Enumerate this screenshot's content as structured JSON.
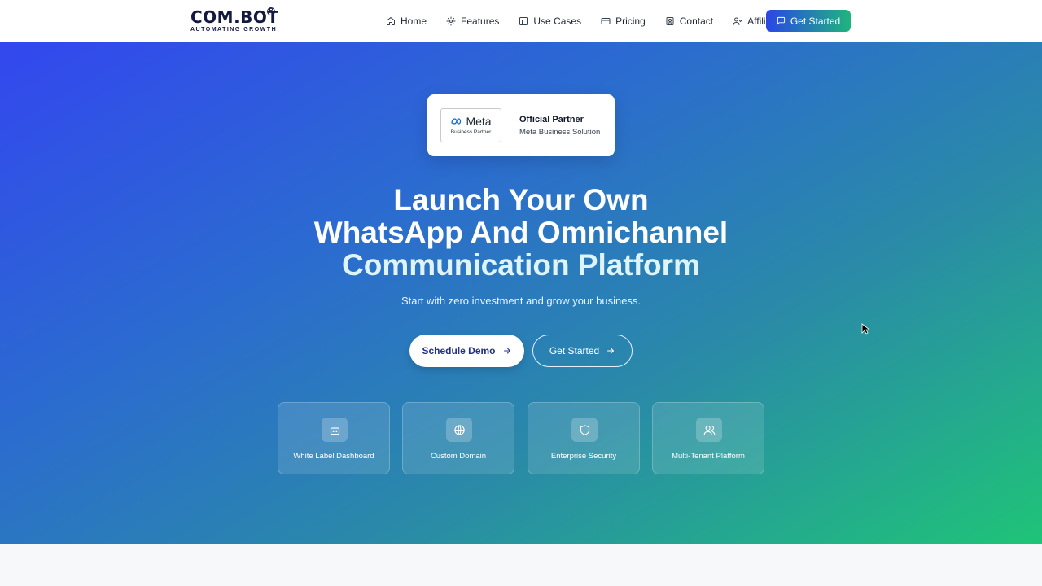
{
  "brand": {
    "name": "COM.BOT",
    "tagline": "AUTOMATING GROWTH",
    "registered_mark": "R"
  },
  "nav": {
    "items": [
      {
        "label": "Home",
        "icon": "home-icon"
      },
      {
        "label": "Features",
        "icon": "gear-icon"
      },
      {
        "label": "Use Cases",
        "icon": "layout-icon"
      },
      {
        "label": "Pricing",
        "icon": "credit-card-icon"
      },
      {
        "label": "Contact",
        "icon": "contact-icon"
      },
      {
        "label": "Affiliate",
        "icon": "users-icon"
      }
    ],
    "cta_label": "Get Started",
    "cta_icon": "message-icon"
  },
  "partner_badge": {
    "logo_text": "Meta",
    "logo_sub": "Business Partner",
    "title": "Official Partner",
    "subtitle": "Meta Business Solution"
  },
  "hero": {
    "headline_line1": "Launch Your Own",
    "headline_line2": "WhatsApp And Omnichannel",
    "headline_line3": "Communication Platform",
    "subtitle": "Start with zero investment and grow your business.",
    "primary_button": "Schedule Demo",
    "secondary_button": "Get Started"
  },
  "features": [
    {
      "label": "White Label Dashboard",
      "icon": "bot-icon"
    },
    {
      "label": "Custom Domain",
      "icon": "globe-icon"
    },
    {
      "label": "Enterprise Security",
      "icon": "shield-icon"
    },
    {
      "label": "Multi-Tenant Platform",
      "icon": "users-icon"
    }
  ],
  "colors": {
    "brand_dark": "#14193f",
    "cta_gradient_start": "#2a46e6",
    "cta_gradient_end": "#1fb57d",
    "hero_gradient_start": "#3347ef",
    "hero_gradient_end": "#1fc478"
  }
}
